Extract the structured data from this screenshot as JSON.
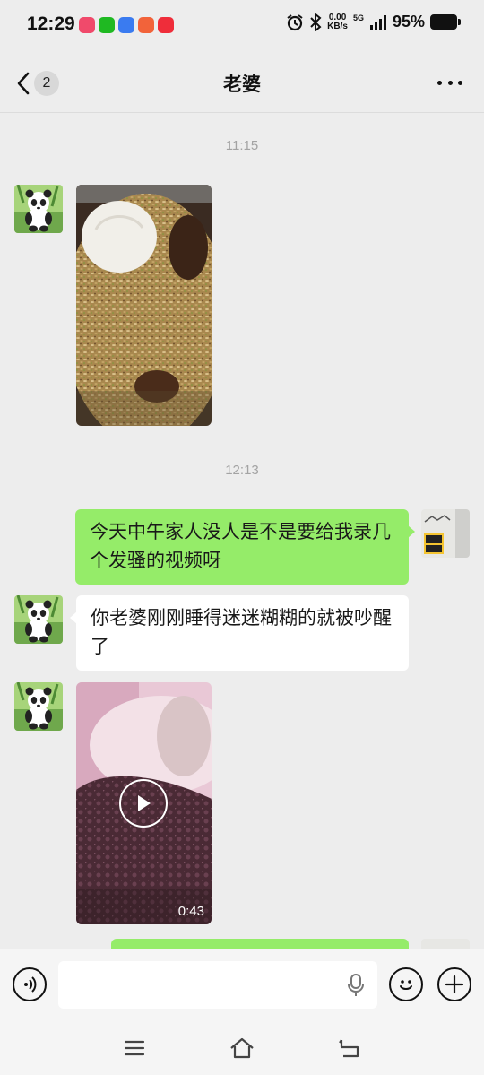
{
  "status_bar": {
    "time": "12:29",
    "net_speed_value": "0.00",
    "net_speed_unit": "KB/s",
    "network": "5G",
    "battery": "95%"
  },
  "header": {
    "unread_count": "2",
    "title": "老婆"
  },
  "messages": [
    {
      "kind": "timestamp",
      "text": "11:15"
    },
    {
      "kind": "image",
      "side": "left",
      "description_icon": "food-photo"
    },
    {
      "kind": "timestamp",
      "text": "12:13"
    },
    {
      "kind": "text",
      "side": "right",
      "text": "今天中午家人没人是不是要给我录几个发骚的视频呀"
    },
    {
      "kind": "text",
      "side": "left",
      "text": "你老婆刚刚睡得迷迷糊糊的就被吵醒了"
    },
    {
      "kind": "video",
      "side": "left",
      "duration": "0:43"
    }
  ],
  "input": {
    "value": "",
    "placeholder": ""
  },
  "colors": {
    "background": "#ededed",
    "sent_bubble": "#95ec69",
    "received_bubble": "#ffffff"
  }
}
